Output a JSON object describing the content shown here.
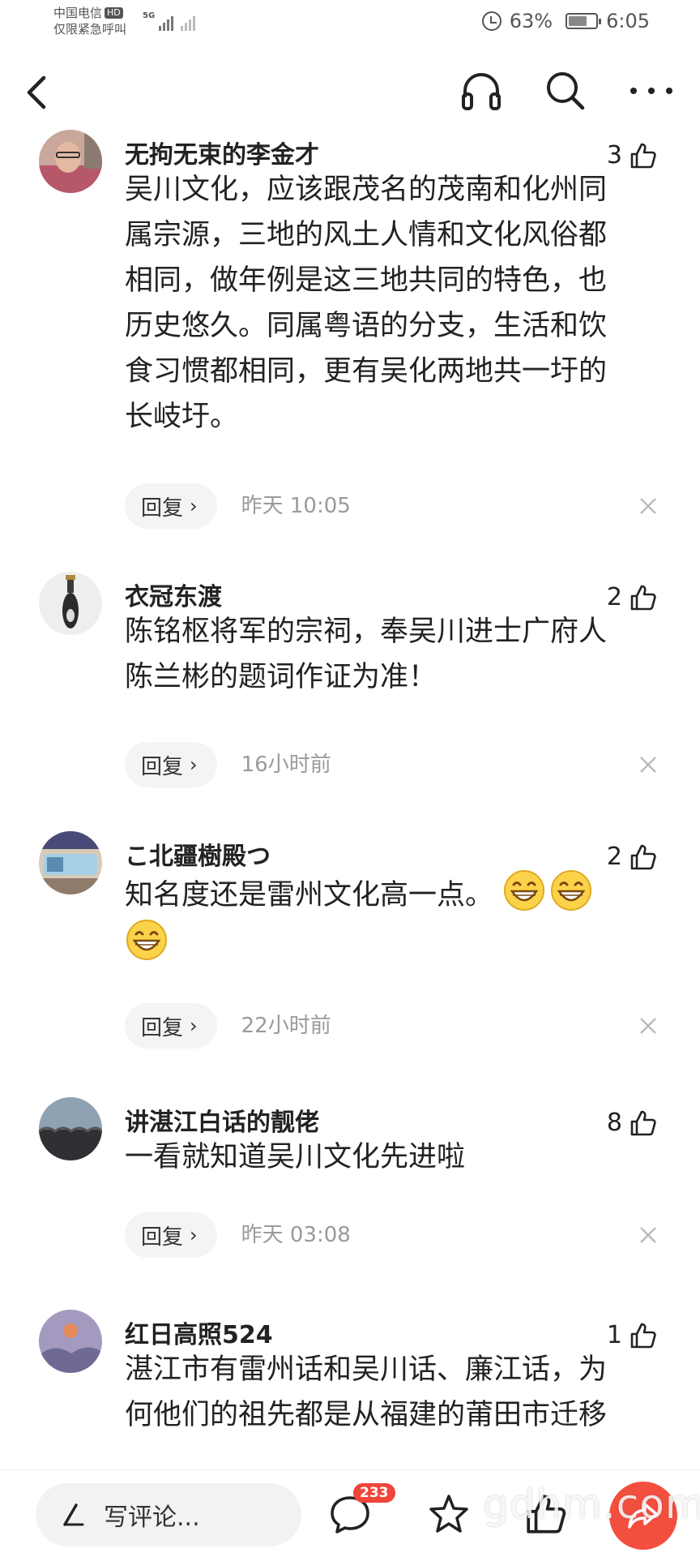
{
  "status_bar": {
    "carrier_line1": "中国电信",
    "carrier_hd": "HD",
    "carrier_line2": "仅限紧急呼叫",
    "network": "5G",
    "battery_percent": "63%",
    "time": "6:05"
  },
  "comments": [
    {
      "username": "无拘无束的李金才",
      "likes": "3",
      "text_lines": [
        "吴川文化，应该跟茂名的茂南和化州同",
        "属宗源，三地的风土人情和文化风俗都",
        "相同，做年例是这三地共同的特色，也",
        "历史悠久。同属粤语的分支，生活和饮",
        "食习惯都相同，更有吴化两地共一圩的",
        "长岐圩。"
      ],
      "reply": "回复",
      "time": "昨天  10:05"
    },
    {
      "username": "衣冠东渡",
      "likes": "2",
      "text_lines": [
        "陈铭枢将军的宗祠，奉吴川进士广府人",
        "陈兰彬的题词作证为准！"
      ],
      "reply": "回复",
      "time": "16小时前"
    },
    {
      "username": "こ北疆樹殿つ",
      "likes": "2",
      "text_lines": [
        "知名度还是雷州文化高一点。"
      ],
      "emoji_count_line1": 2,
      "emoji_count_line2": 1,
      "reply": "回复",
      "time": "22小时前"
    },
    {
      "username": "讲湛江白话的靓佬",
      "likes": "8",
      "text_lines": [
        "一看就知道吴川文化先进啦"
      ],
      "reply": "回复",
      "time": "昨天  03:08"
    },
    {
      "username": "红日高照524",
      "likes": "1",
      "text_lines": [
        "湛江市有雷州话和吴川话、廉江话，为",
        "何他们的祖先都是从福建的莆田市迁移"
      ]
    }
  ],
  "bottom_bar": {
    "input_placeholder": "写评论...",
    "comment_count": "233",
    "watermark": "gdhm.com"
  },
  "colors": {
    "accent_red": "#f34f3f",
    "badge_red": "#f0453a",
    "muted_text": "#9a9a9a"
  }
}
